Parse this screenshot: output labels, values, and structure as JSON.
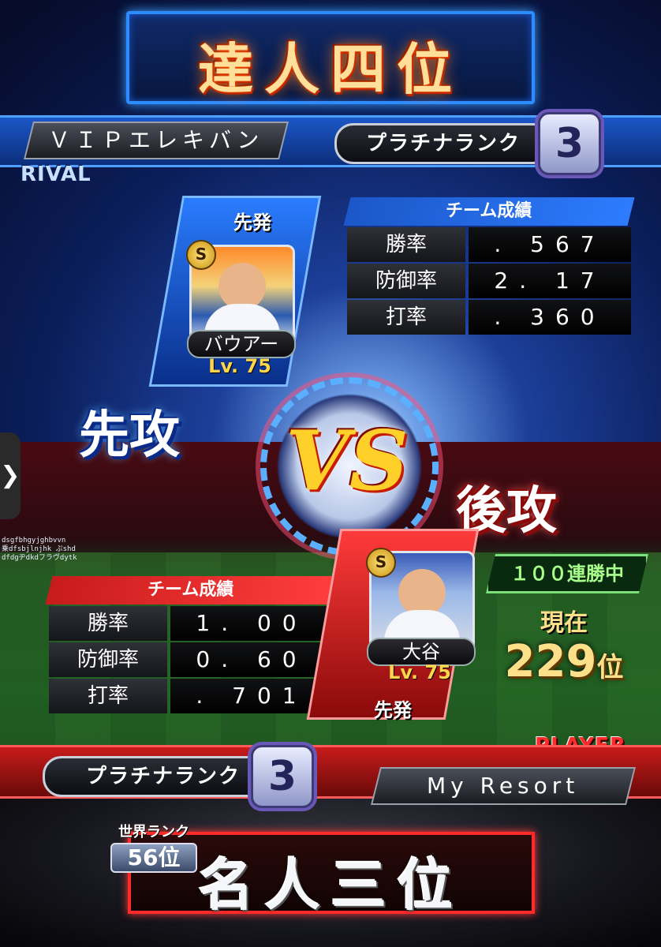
{
  "header": {
    "title": "達人四位"
  },
  "rival": {
    "tag": "RIVAL",
    "name": "ＶＩＰエレキバン",
    "rank_label": "プラチナランク",
    "rank_num": "3",
    "starter_label": "先発",
    "player_name": "バウアー",
    "player_lv": "Lv. 75",
    "grade": "S",
    "stats_header": "チーム成績",
    "stats": [
      {
        "label": "勝率",
        "value": ". 567"
      },
      {
        "label": "防御率",
        "value": "2. 17"
      },
      {
        "label": "打率",
        "value": ". 360"
      }
    ],
    "order": "先攻"
  },
  "vs": {
    "text": "VS"
  },
  "player": {
    "tag": "PLAYER",
    "name": "My Resort",
    "rank_label": "プラチナランク",
    "rank_num": "3",
    "starter_label": "先発",
    "player_name": "大谷",
    "player_lv": "Lv. 75",
    "grade": "S",
    "stats_header": "チーム成績",
    "stats": [
      {
        "label": "勝率",
        "value": "1. 00"
      },
      {
        "label": "防御率",
        "value": "0. 60"
      },
      {
        "label": "打率",
        "value": ". 701"
      }
    ],
    "order": "後攻",
    "streak": "１００連勝中",
    "current_label": "現在",
    "current_rank": "229",
    "current_suffix": "位",
    "world_rank_label": "世界ランク",
    "world_rank": "56位",
    "title": "名人三位"
  },
  "ui": {
    "side_tab": "❯",
    "tiny_text": "dsgfbhgyjghbvvn\n乗dfsbjlnjhk ぷshd\ndfdgヂdkdフラヴdytk"
  }
}
